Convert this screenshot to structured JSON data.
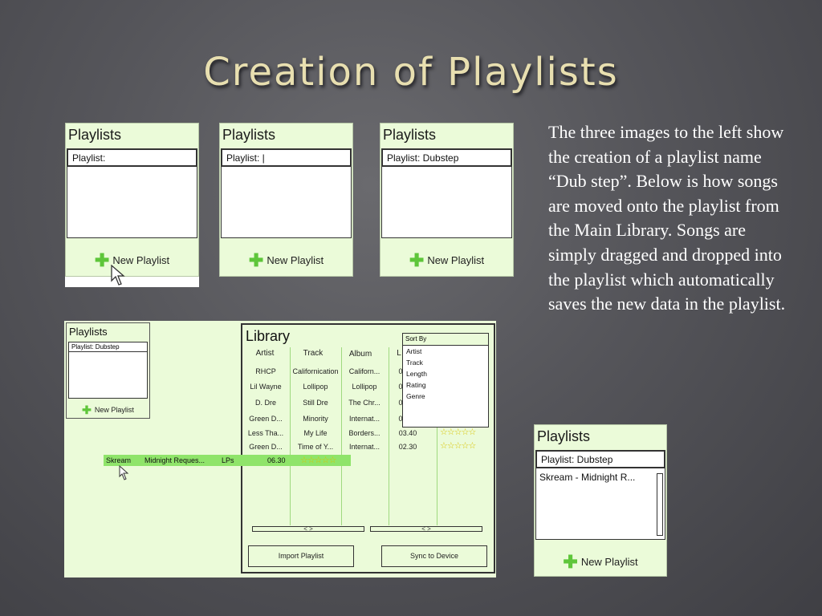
{
  "slide_title": "Creation of Playlists",
  "description": "The three images to the left show the creation of a playlist name “Dub step”.  Below is how songs are moved onto the playlist from the Main Library. Songs are simply dragged and dropped into the playlist which automatically saves the new data in the playlist.",
  "panels": [
    {
      "header": "Playlists",
      "name": "Playlist:",
      "button": "New Playlist"
    },
    {
      "header": "Playlists",
      "name": "Playlist: |",
      "button": "New Playlist"
    },
    {
      "header": "Playlists",
      "name": "Playlist: Dubstep",
      "button": "New Playlist"
    }
  ],
  "library_view": {
    "playlist": {
      "header": "Playlists",
      "name": "Playlist: Dubstep",
      "button": "New Playlist"
    },
    "library_title": "Library",
    "columns": [
      "Artist",
      "Track",
      "Album",
      "L"
    ],
    "rows": [
      {
        "artist": "RHCP",
        "track": "Californication",
        "album": "Californ...",
        "length": "0"
      },
      {
        "artist": "Lil Wayne",
        "track": "Lollipop",
        "album": "Lollipop",
        "length": "0"
      },
      {
        "artist": "D. Dre",
        "track": "Still Dre",
        "album": "The Chr...",
        "length": "0"
      },
      {
        "artist": "Green D...",
        "track": "Minority",
        "album": "Internat...",
        "length": "0"
      },
      {
        "artist": "Less Tha...",
        "track": "My Life",
        "album": "Borders...",
        "length": "03.40"
      },
      {
        "artist": "Green D...",
        "track": "Time of Y...",
        "album": "Internat...",
        "length": "02.30"
      }
    ],
    "stars": [
      "☆☆☆☆☆",
      "☆☆☆☆☆"
    ],
    "sort_by": {
      "title": "Sort By",
      "options": [
        "Artist",
        "Track",
        "Length",
        "Rating",
        "Genre"
      ]
    },
    "scroll_arrows": "< >",
    "import_button": "Import Playlist",
    "sync_button": "Sync to Device",
    "dragged": {
      "artist": "Skream",
      "track": "Midnight Reques...",
      "album": "LPs",
      "length": "06.30",
      "stars": "☆☆☆☆☆"
    }
  },
  "result_panel": {
    "header": "Playlists",
    "name": "Playlist: Dubstep",
    "song": "Skream - Midnight R...",
    "button": "New Playlist"
  }
}
